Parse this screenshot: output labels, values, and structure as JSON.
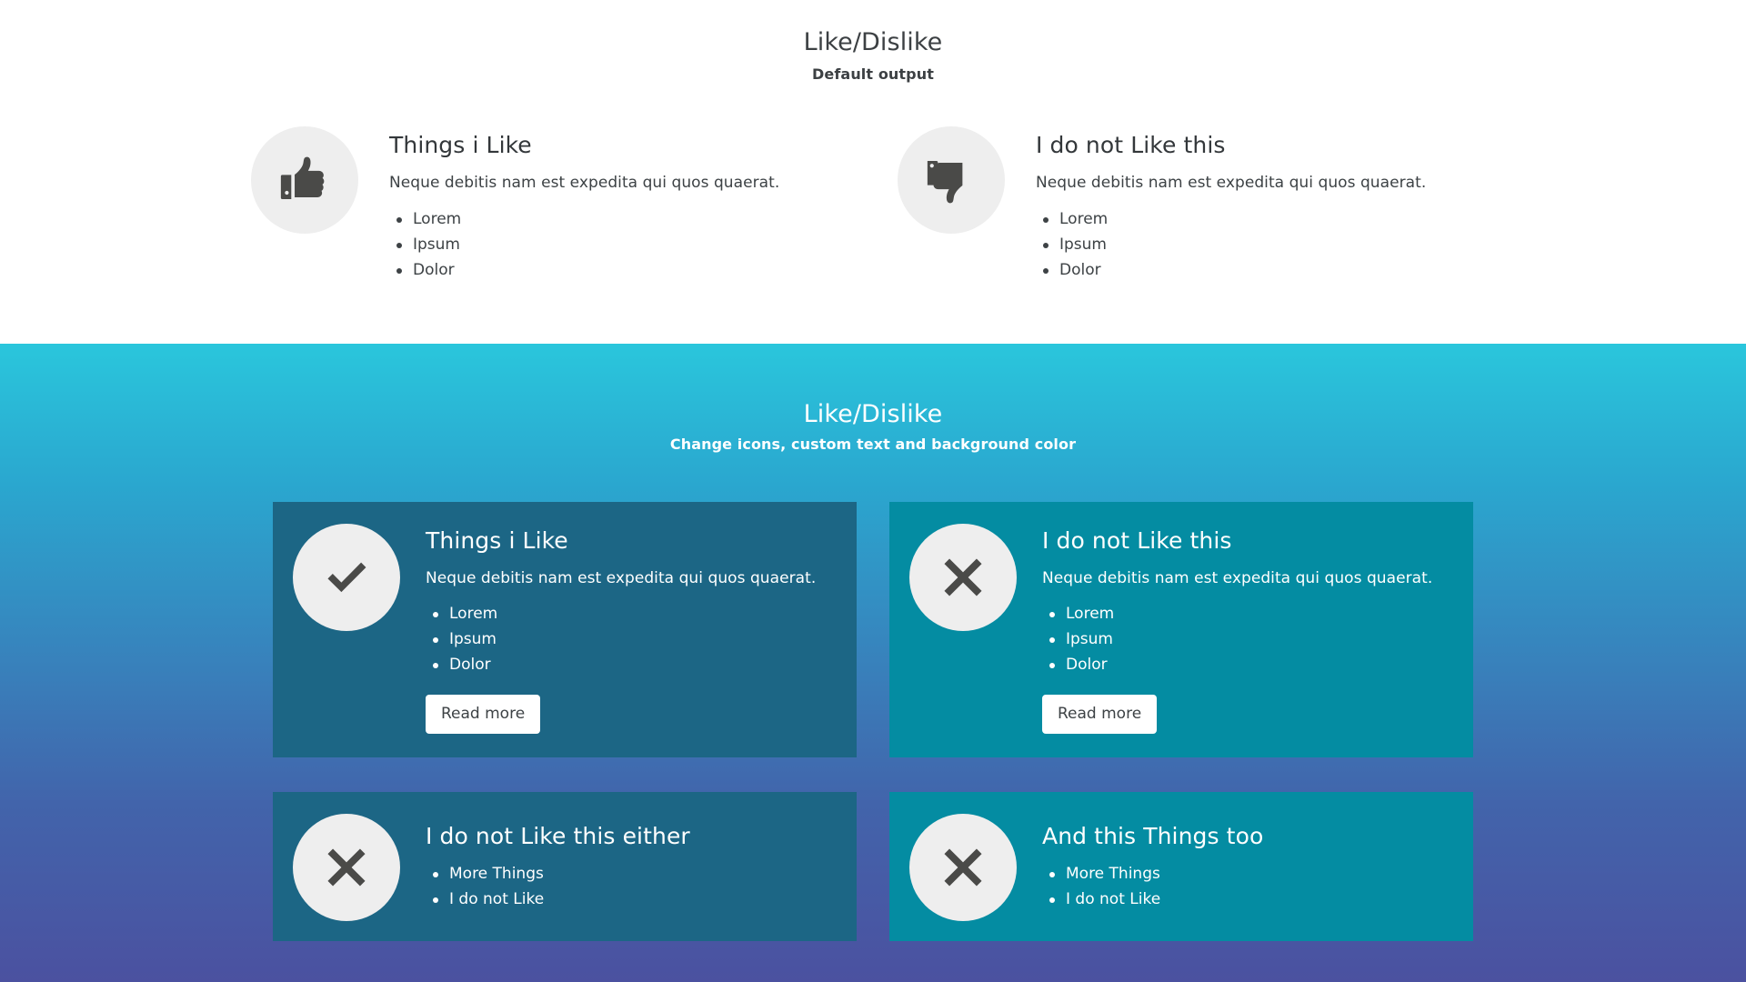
{
  "sections": [
    {
      "title": "Like/Dislike",
      "subtitle": "Default output",
      "style": "default-white",
      "cards": [
        {
          "icon": "thumbs-up-icon",
          "heading": "Things i Like",
          "description": "Neque debitis nam est expedita qui quos quaerat.",
          "items": [
            "Lorem",
            "Ipsum",
            "Dolor"
          ],
          "button": null
        },
        {
          "icon": "thumbs-down-icon",
          "heading": "I do not Like this",
          "description": "Neque debitis nam est expedita qui quos quaerat.",
          "items": [
            "Lorem",
            "Ipsum",
            "Dolor"
          ],
          "button": null
        }
      ]
    },
    {
      "title": "Like/Dislike",
      "subtitle": "Change icons, custom text and background color",
      "style": "gradient",
      "cards": [
        {
          "icon": "check-icon",
          "heading": "Things i Like",
          "description": "Neque debitis nam est expedita qui quos quaerat.",
          "items": [
            "Lorem",
            "Ipsum",
            "Dolor"
          ],
          "button": "Read more",
          "background": "#1c6685"
        },
        {
          "icon": "cross-icon",
          "heading": "I do not Like this",
          "description": "Neque debitis nam est expedita qui quos quaerat.",
          "items": [
            "Lorem",
            "Ipsum",
            "Dolor"
          ],
          "button": "Read more",
          "background": "#048ca2"
        },
        {
          "icon": "cross-icon",
          "heading": "I do not Like this either",
          "description": null,
          "items": [
            "More Things",
            "I do not Like"
          ],
          "button": null,
          "background": "#1c6685"
        },
        {
          "icon": "cross-icon",
          "heading": "And this Things too",
          "description": null,
          "items": [
            "More Things",
            "I do not Like"
          ],
          "button": null,
          "background": "#048ca2"
        }
      ]
    }
  ],
  "colors": {
    "page_background": "#ffffff",
    "gradient_top": "#2ac6dc",
    "gradient_bottom": "#4b51a0",
    "card_teal_dark": "#1c6685",
    "card_teal_bright": "#048ca2",
    "icon_circle": "#eeeeee",
    "icon_glyph": "#4a4a48",
    "text_dark": "#3d4245",
    "text_light": "#ffffff",
    "button_background": "#ffffff"
  }
}
